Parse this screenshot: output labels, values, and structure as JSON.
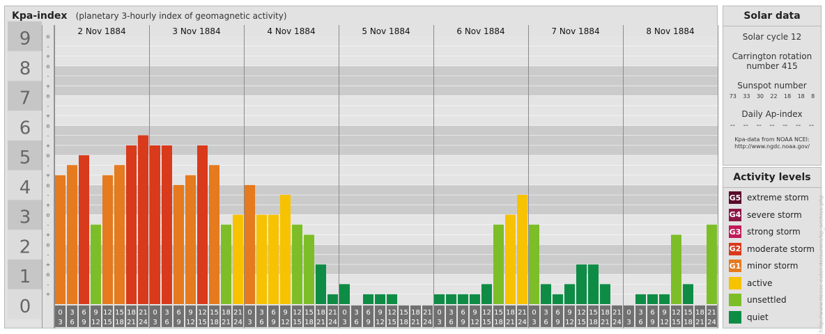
{
  "header": {
    "title": "Kpa-index",
    "subtitle": "(planetary 3-hourly index of geomagnetic activity)"
  },
  "chart_data": {
    "type": "bar",
    "title": "Kpa-index",
    "subtitle": "(planetary 3-hourly index of geomagnetic activity)",
    "ylim": [
      0,
      9
    ],
    "y_ticks": [
      "0",
      "1",
      "2",
      "3",
      "4",
      "5",
      "6",
      "7",
      "8",
      "9"
    ],
    "minor_tick_labels": [
      "-",
      "o",
      "+"
    ],
    "days": [
      "2 Nov 1884",
      "3 Nov 1884",
      "4 Nov 1884",
      "5 Nov 1884",
      "6 Nov 1884",
      "7 Nov 1884",
      "8 Nov 1884"
    ],
    "interval_labels": [
      [
        "0",
        "3"
      ],
      [
        "3",
        "6"
      ],
      [
        "6",
        "9"
      ],
      [
        "9",
        "12"
      ],
      [
        "12",
        "15"
      ],
      [
        "15",
        "18"
      ],
      [
        "18",
        "21"
      ],
      [
        "21",
        "24"
      ]
    ],
    "values": [
      [
        4.33,
        4.67,
        5.0,
        2.67,
        4.33,
        4.67,
        5.33,
        5.67
      ],
      [
        5.33,
        5.33,
        4.0,
        4.33,
        5.33,
        4.67,
        2.67,
        3.0
      ],
      [
        4.0,
        3.0,
        3.0,
        3.67,
        2.67,
        2.33,
        1.33,
        0.33
      ],
      [
        0.67,
        0.0,
        0.33,
        0.33,
        0.33,
        0.0,
        0.0,
        0.0
      ],
      [
        0.33,
        0.33,
        0.33,
        0.33,
        0.67,
        2.67,
        3.0,
        3.67
      ],
      [
        2.67,
        0.67,
        0.33,
        0.67,
        1.33,
        1.33,
        0.67,
        0.0
      ],
      [
        0.0,
        0.33,
        0.33,
        0.33,
        2.33,
        0.67,
        0.0,
        2.67
      ]
    ],
    "colors": {
      "quiet": "#0e8c45",
      "unsettled": "#7dbe28",
      "active": "#f7c200",
      "minor": "#e57a1e",
      "moderate": "#d93a1b"
    }
  },
  "solar": {
    "title": "Solar data",
    "cycle": "Solar cycle 12",
    "carrington_line1": "Carrington rotation",
    "carrington_line2": "number 415",
    "sunspot_title": "Sunspot number",
    "sunspots": [
      "73",
      "33",
      "30",
      "22",
      "18",
      "18",
      "8"
    ],
    "ap_title": "Daily Ap-index",
    "ap_values": [
      "--",
      "--",
      "--",
      "--",
      "--",
      "--",
      "--"
    ],
    "source_line1": "Kpa-data from NOAA NCEI:",
    "source_line2": "http://www.ngdc.noaa.gov/"
  },
  "levels": {
    "title": "Activity levels",
    "items": [
      {
        "badge": "G5",
        "label": "extreme storm",
        "color": "#5a0a2a"
      },
      {
        "badge": "G4",
        "label": "severe storm",
        "color": "#8a1646"
      },
      {
        "badge": "G3",
        "label": "strong storm",
        "color": "#c01a5a"
      },
      {
        "badge": "G2",
        "label": "moderate storm",
        "color": "#d93a1b"
      },
      {
        "badge": "G1",
        "label": "minor storm",
        "color": "#e57a1e"
      },
      {
        "badge": "",
        "label": "active",
        "color": "#f7c200"
      },
      {
        "badge": "",
        "label": "unsettled",
        "color": "#7dbe28"
      },
      {
        "badge": "",
        "label": "quiet",
        "color": "#0e8c45"
      }
    ]
  },
  "credit": "http://www.tiesse-euter.de/aurora/kp_archive.php"
}
